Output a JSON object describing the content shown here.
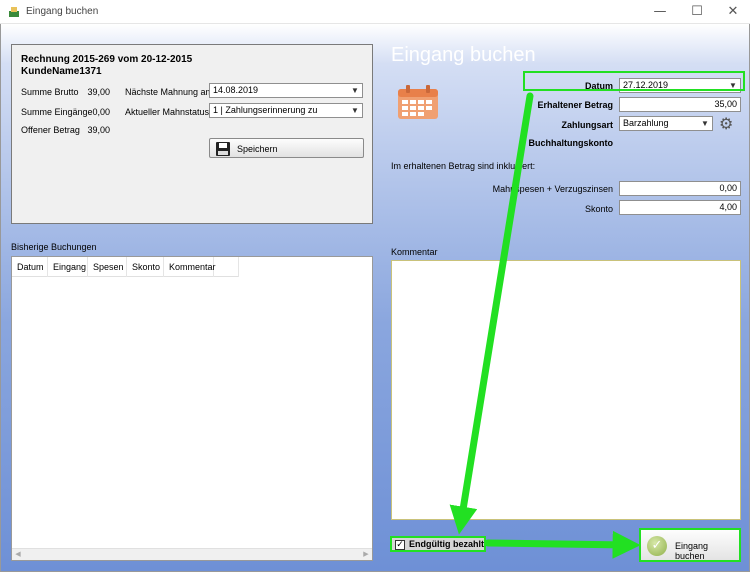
{
  "window": {
    "title": "Eingang buchen",
    "minimize_glyph": "—",
    "maximize_glyph": "☐",
    "close_glyph": "✕"
  },
  "invoice": {
    "title_line1": "Rechnung 2015-269 vom 20-12-2015",
    "title_line2": "KundeName1371",
    "brutto_label": "Summe Brutto",
    "brutto_value": "39,00",
    "eingaenge_label": "Summe Eingänge",
    "eingaenge_value": "0,00",
    "offen_label": "Offener Betrag",
    "offen_value": "39,00",
    "mahnung_label": "Nächste Mahnung am",
    "mahnung_value": "14.08.2019",
    "mahnstatus_label": "Aktueller Mahnstatus",
    "mahnstatus_value": "1 | Zahlungserinnerung zu",
    "save_label": "Speichern"
  },
  "bookings": {
    "caption": "Bisherige Buchungen",
    "columns": [
      "Datum",
      "Eingang",
      "Spesen",
      "Skonto",
      "Kommentar"
    ]
  },
  "form": {
    "heading": "Eingang buchen",
    "datum_label": "Datum",
    "datum_value": "27.12.2019",
    "betrag_label": "Erhaltener Betrag",
    "betrag_value": "35,00",
    "zahlungsart_label": "Zahlungsart",
    "zahlungsart_value": "Barzahlung",
    "konto_label": "Buchhaltungskonto",
    "included_note": "Im erhaltenen Betrag sind inkludiert:",
    "spesen_label": "Mahnspesen + Verzugszinsen",
    "spesen_value": "0,00",
    "skonto_label": "Skonto",
    "skonto_value": "4,00",
    "kommentar_label": "Kommentar",
    "paid_checkbox_label": "Endgültig bezahlt",
    "book_button_label": "Eingang buchen"
  },
  "colors": {
    "annotation": "#22e022"
  }
}
